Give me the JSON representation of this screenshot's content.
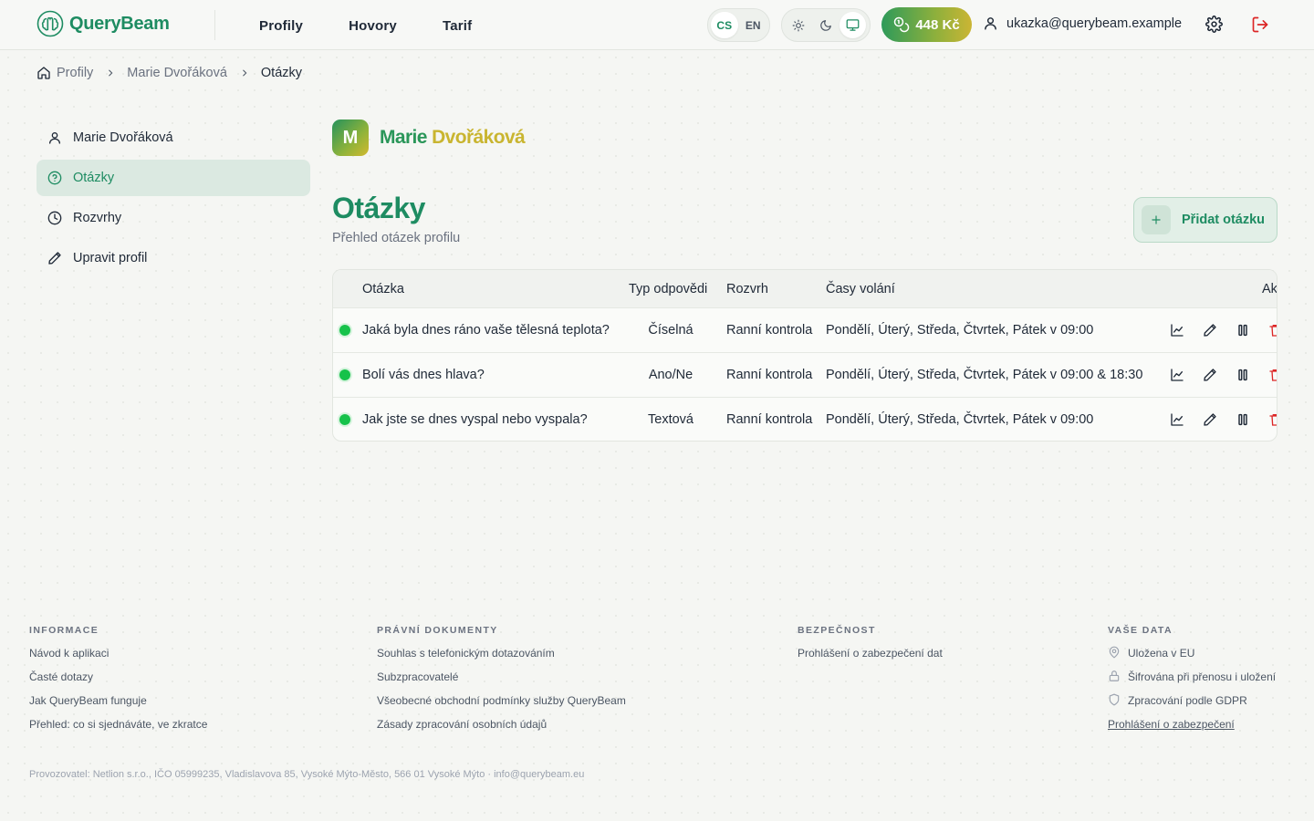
{
  "app": {
    "name": "QueryBeam"
  },
  "header": {
    "nav": [
      "Profily",
      "Hovory",
      "Tarif"
    ],
    "languages": [
      {
        "code": "CS",
        "active": true
      },
      {
        "code": "EN",
        "active": false
      }
    ],
    "theme_modes": [
      {
        "icon": "sun-icon",
        "active": false
      },
      {
        "icon": "moon-icon",
        "active": false
      },
      {
        "icon": "monitor-icon",
        "active": true
      }
    ],
    "credit": "448 Kč",
    "user_email": "ukazka@querybeam.example"
  },
  "breadcrumb": [
    "Profily",
    "Marie Dvořáková",
    "Otázky"
  ],
  "sidebar": {
    "items": [
      {
        "label": "Marie Dvořáková",
        "icon": "user-icon",
        "active": false
      },
      {
        "label": "Otázky",
        "icon": "help-circle-icon",
        "active": true
      },
      {
        "label": "Rozvrhy",
        "icon": "clock-icon",
        "active": false
      },
      {
        "label": "Upravit profil",
        "icon": "pencil-icon",
        "active": false
      }
    ]
  },
  "profile": {
    "initial": "M",
    "first_name": "Marie",
    "last_name": "Dvořáková"
  },
  "page": {
    "title": "Otázky",
    "subtitle": "Přehled otázek profilu",
    "add_button": "Přidat otázku"
  },
  "table": {
    "headers": {
      "question": "Otázka",
      "type": "Typ odpovědi",
      "schedule": "Rozvrh",
      "times": "Časy volání",
      "actions": "Akce"
    },
    "rows": [
      {
        "status": "active",
        "question": "Jaká byla dnes ráno vaše tělesná teplota?",
        "type": "Číselná",
        "schedule": "Ranní kontrola",
        "times": "Pondělí, Úterý, Středa, Čtvrtek, Pátek v 09:00"
      },
      {
        "status": "active",
        "question": "Bolí vás dnes hlava?",
        "type": "Ano/Ne",
        "schedule": "Ranní kontrola",
        "times": "Pondělí, Úterý, Středa, Čtvrtek, Pátek v 09:00 & 18:30"
      },
      {
        "status": "active",
        "question": "Jak jste se dnes vyspal nebo vyspala?",
        "type": "Textová",
        "schedule": "Ranní kontrola",
        "times": "Pondělí, Úterý, Středa, Čtvrtek, Pátek v 09:00"
      }
    ]
  },
  "footer": {
    "info": {
      "heading": "INFORMACE",
      "links": [
        "Návod k aplikaci",
        "Časté dotazy",
        "Jak QueryBeam funguje",
        "Přehled: co si sjednáváte, ve zkratce"
      ]
    },
    "legal": {
      "heading": "PRÁVNÍ DOKUMENTY",
      "links": [
        "Souhlas s telefonickým dotazováním",
        "Subzpracovatelé",
        "Všeobecné obchodní podmínky služby QueryBeam",
        "Zásady zpracování osobních údajů"
      ]
    },
    "security": {
      "heading": "BEZPEČNOST",
      "links": [
        "Prohlášení o zabezpečení dat"
      ]
    },
    "data": {
      "heading": "VAŠE DATA",
      "items": [
        {
          "icon": "map-pin-icon",
          "label": "Uložena v EU"
        },
        {
          "icon": "lock-icon",
          "label": "Šifrována při přenosu i uložení"
        },
        {
          "icon": "shield-icon",
          "label": "Zpracování podle GDPR"
        }
      ],
      "link": "Prohlášení o zabezpečení"
    },
    "operator": "Provozovatel: Netlion s.r.o., IČO 05999235, Vladislavova 85, Vysoké Mýto-Město, 566 01 Vysoké Mýto · info@querybeam.eu"
  },
  "colors": {
    "brand": "#1e8c62",
    "accent_gold": "#c9b530",
    "status_active": "#16c24a",
    "danger": "#dc2626"
  }
}
